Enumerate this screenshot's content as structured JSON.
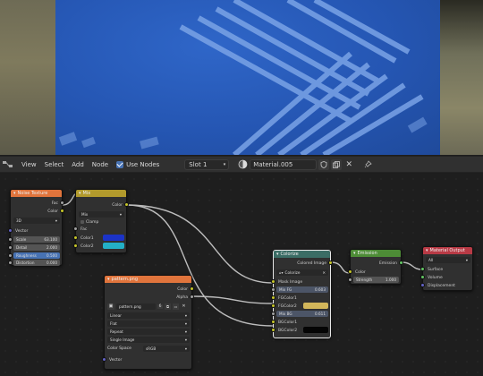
{
  "header": {
    "menus": [
      "View",
      "Select",
      "Add",
      "Node"
    ],
    "use_nodes_label": "Use Nodes",
    "slot": "Slot 1",
    "material": "Material.005"
  },
  "nodes": {
    "noise": {
      "title": "Noise Texture",
      "out_fac": "Fac",
      "out_color": "Color",
      "dimension": "3D",
      "in_vector": "Vector",
      "scale_label": "Scale",
      "scale_value": "63.100",
      "detail_label": "Detail",
      "detail_value": "2.000",
      "roughness_label": "Roughness",
      "roughness_value": "0.500",
      "distortion_label": "Distortion",
      "distortion_value": "0.000"
    },
    "mix": {
      "title": "Mix",
      "out_color": "Color",
      "blend": "Mix",
      "clamp_label": "Clamp",
      "in_fac": "Fac",
      "in_color1": "Color1",
      "in_color2": "Color2",
      "color1": "#1b33c8",
      "color2": "#23b0c6"
    },
    "image": {
      "title": "pattern.png",
      "out_color": "Color",
      "out_alpha": "Alpha",
      "image_name": "pattern.png",
      "users": "6",
      "interpolation": "Linear",
      "projection": "Flat",
      "extension": "Repeat",
      "source": "Single Image",
      "colorspace_label": "Color Space",
      "colorspace_value": "sRGB",
      "in_vector": "Vector"
    },
    "colorize": {
      "title": "Colorize",
      "out_label": "Colored Image",
      "mode": "Colorize",
      "in_mask": "Mask Image",
      "mix_fg_label": "Mix FG",
      "mix_fg_value": "0.603",
      "fgcolor1": "FGColor1",
      "fgcolor2": "FGColor2",
      "mix_bg_label": "Mix BG",
      "mix_bg_value": "0.611",
      "bgcolor1": "BGColor1",
      "bgcolor2": "BGColor2",
      "fg2_color": "#d2b65a",
      "bg2_color": "#050505"
    },
    "emission": {
      "title": "Emission",
      "out_label": "Emission",
      "in_color": "Color",
      "strength_label": "Strength",
      "strength_value": "1.000"
    },
    "output": {
      "title": "Material Output",
      "target": "All",
      "in_surface": "Surface",
      "in_volume": "Volume",
      "in_displacement": "Displacement"
    }
  }
}
